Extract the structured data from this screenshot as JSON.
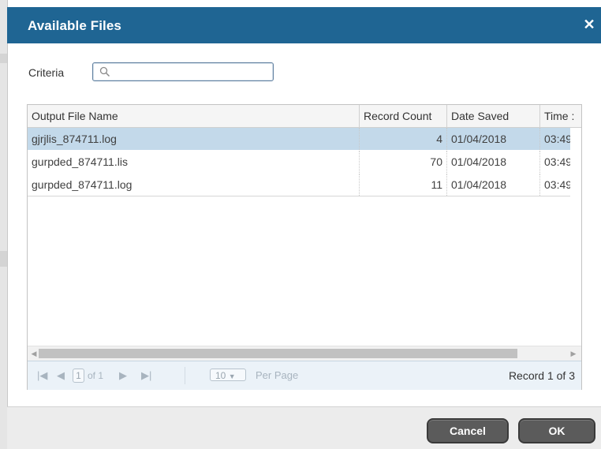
{
  "dialog": {
    "title": "Available Files",
    "close_icon": "close-icon"
  },
  "criteria": {
    "label": "Criteria",
    "value": "",
    "placeholder": "",
    "icon": "search-icon"
  },
  "grid": {
    "columns": [
      "Output File Name",
      "Record Count",
      "Date Saved",
      "Time :"
    ],
    "rows": [
      {
        "name": "gjrjlis_874711.log",
        "count": "4",
        "date": "01/04/2018",
        "time": "03:49:",
        "selected": true
      },
      {
        "name": "gurpded_874711.lis",
        "count": "70",
        "date": "01/04/2018",
        "time": "03:49:",
        "selected": false
      },
      {
        "name": "gurpded_874711.log",
        "count": "11",
        "date": "01/04/2018",
        "time": "03:49:",
        "selected": false
      }
    ]
  },
  "pager": {
    "first_icon": "first-page-icon",
    "prev_icon": "prev-page-icon",
    "current_page": "1",
    "of_label": "of 1",
    "next_icon": "next-page-icon",
    "last_icon": "last-page-icon",
    "page_size": "10",
    "per_page_label": "Per Page",
    "record_info": "Record 1 of 3"
  },
  "footer": {
    "cancel_label": "Cancel",
    "ok_label": "OK"
  },
  "colors": {
    "title_bar": "#1f6593",
    "selected_row": "#c3d9ea",
    "button": "#5b5b5b"
  }
}
